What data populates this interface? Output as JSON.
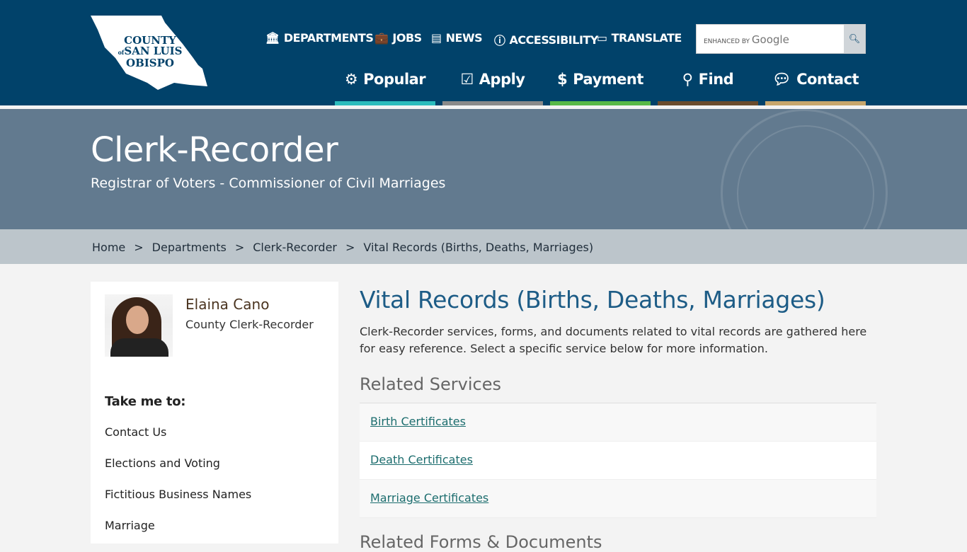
{
  "header": {
    "logo": {
      "line1": "COUNTY",
      "of": "of",
      "line2": "SAN LUIS",
      "line3": "OBISPO"
    },
    "utility_nav": [
      {
        "label": "DEPARTMENTS",
        "icon": "institution-icon"
      },
      {
        "label": "JOBS",
        "icon": "briefcase-icon"
      },
      {
        "label": "NEWS",
        "icon": "newspaper-icon"
      },
      {
        "label": "ACCESSIBILITY",
        "icon": "accessibility-icon"
      },
      {
        "label": "TRANSLATE",
        "icon": "translate-icon"
      }
    ],
    "search": {
      "enhanced_by": "ENHANCED BY",
      "brand": "Google",
      "button_icon": "search-icon"
    },
    "main_nav": [
      {
        "label": "Popular",
        "icon": "gear-icon",
        "color": "#2bbcbc"
      },
      {
        "label": "Apply",
        "icon": "checkbox-icon",
        "color": "#8a8a8a"
      },
      {
        "label": "Payment",
        "icon": "dollar-icon",
        "color": "#58b947"
      },
      {
        "label": "Find",
        "icon": "search-icon",
        "color": "#6b4c2d"
      },
      {
        "label": "Contact",
        "icon": "chat-icon",
        "color": "#c7a66c"
      }
    ]
  },
  "banner": {
    "title": "Clerk-Recorder",
    "subtitle": "Registrar of Voters - Commissioner of Civil Marriages"
  },
  "breadcrumb": [
    "Home",
    "Departments",
    "Clerk-Recorder",
    "Vital Records (Births, Deaths, Marriages)"
  ],
  "breadcrumb_sep": ">",
  "sidebar": {
    "name": "Elaina Cano",
    "title": "County Clerk-Recorder",
    "heading": "Take me to:",
    "links": [
      "Contact Us",
      "Elections and Voting",
      "Fictitious Business Names",
      "Marriage"
    ]
  },
  "main": {
    "title": "Vital Records (Births, Deaths, Marriages)",
    "intro": "Clerk-Recorder services, forms, and documents related to vital records are gathered here for easy reference. Select a specific service below for more information.",
    "related_services_heading": "Related Services",
    "services": [
      "Birth Certificates",
      "Death Certificates",
      "Marriage Certificates"
    ],
    "related_forms_heading": "Related Forms & Documents"
  }
}
